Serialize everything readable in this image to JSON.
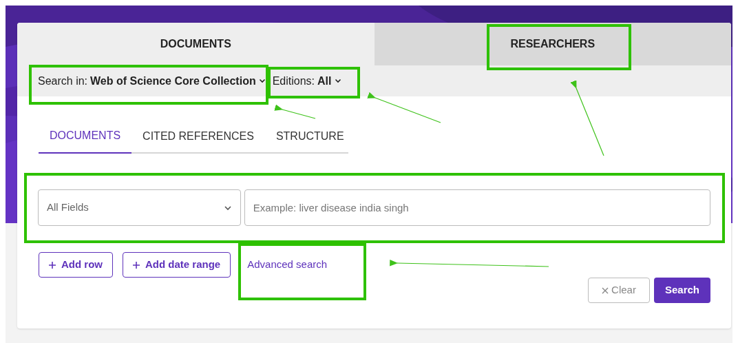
{
  "top_tabs": [
    {
      "label": "DOCUMENTS",
      "selected": true
    },
    {
      "label": "RESEARCHERS",
      "selected": false
    }
  ],
  "search_in": {
    "label": "Search in:",
    "value": "Web of Science Core Collection"
  },
  "editions": {
    "label": "Editions:",
    "value": "All"
  },
  "sub_tabs": [
    {
      "label": "DOCUMENTS",
      "selected": true
    },
    {
      "label": "CITED REFERENCES",
      "selected": false
    },
    {
      "label": "STRUCTURE",
      "selected": false
    }
  ],
  "field_select": {
    "value": "All Fields"
  },
  "search_field": {
    "placeholder": "Example: liver disease india singh"
  },
  "add_buttons": [
    "Add row",
    "Add date range"
  ],
  "advanced_link": "Advanced search",
  "clear_button": "Clear",
  "search_button": "Search"
}
